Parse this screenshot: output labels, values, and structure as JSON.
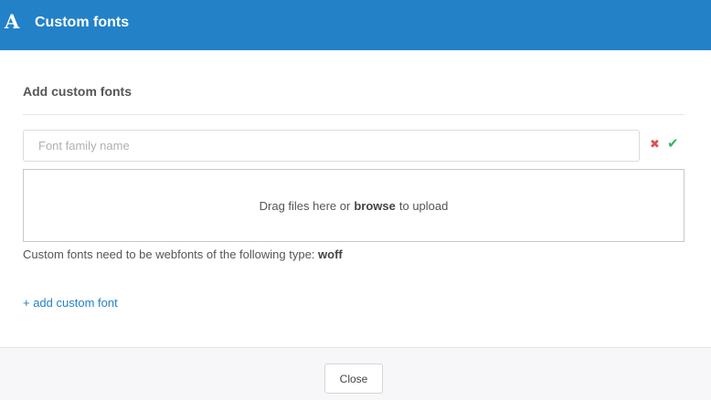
{
  "header": {
    "icon": "A",
    "title": "Custom fonts"
  },
  "section": {
    "title": "Add custom fonts"
  },
  "font_form": {
    "family_placeholder": "Font family name",
    "family_value": "",
    "cancel_icon": "✖",
    "confirm_icon": "✔",
    "dropzone": {
      "before": "Drag files here or",
      "browse_label": "browse",
      "after": "to upload"
    }
  },
  "help": {
    "text": "Custom fonts need to be webfonts of the following type:",
    "type": "woff"
  },
  "add_link": "+ add custom font",
  "footer": {
    "close_label": "Close"
  },
  "colors": {
    "header_bg": "#2381c8",
    "link": "#2381c8",
    "cancel": "#d9534f",
    "confirm": "#2eb85c"
  }
}
